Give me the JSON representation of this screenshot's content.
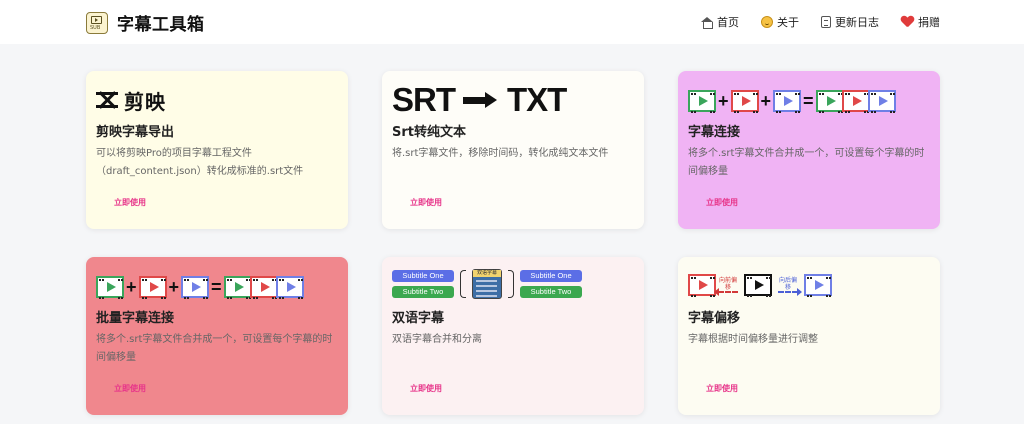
{
  "brand": {
    "logo_text": "SUB",
    "title": "字幕工具箱"
  },
  "nav": [
    {
      "label": "首页",
      "icon": "home-icon"
    },
    {
      "label": "关于",
      "icon": "smile-icon"
    },
    {
      "label": "更新日志",
      "icon": "log-icon"
    },
    {
      "label": "捐赠",
      "icon": "heart-icon"
    }
  ],
  "colors": {
    "card_yellow": "#fffde7",
    "card_white": "#fefdf8",
    "card_purple": "#f0b3f4",
    "card_red": "#f0878d",
    "card_pink": "#fcf1f2",
    "card_cream": "#fdfcf2",
    "accent_link": "#e7358a"
  },
  "cards": [
    {
      "title": "剪映字幕导出",
      "desc": "可以将剪映Pro的项目字幕工程文件（draft_content.json）转化成标准的.srt文件",
      "action": "立即使用",
      "visual_text": "剪映"
    },
    {
      "title": "Srt转纯文本",
      "desc": "将.srt字幕文件，移除时间码，转化成纯文本文件",
      "action": "立即使用",
      "visual_left": "SRT",
      "visual_right": "TXT"
    },
    {
      "title": "字幕连接",
      "desc": "将多个.srt字幕文件合并成一个，可设置每个字幕的时间偏移量",
      "action": "立即使用"
    },
    {
      "title": "批量字幕连接",
      "desc": "将多个.srt字幕文件合并成一个，可设置每个字幕的时间偏移量",
      "action": "立即使用"
    },
    {
      "title": "双语字幕",
      "desc": "双语字幕合并和分离",
      "action": "立即使用",
      "pill_one": "Subtitle One",
      "pill_two": "Subtitle Two",
      "doc_label": "双语字幕"
    },
    {
      "title": "字幕偏移",
      "desc": "字幕根据时间偏移量进行调整",
      "action": "立即使用",
      "back_label": "向前偏移",
      "fwd_label": "向后偏移"
    }
  ]
}
